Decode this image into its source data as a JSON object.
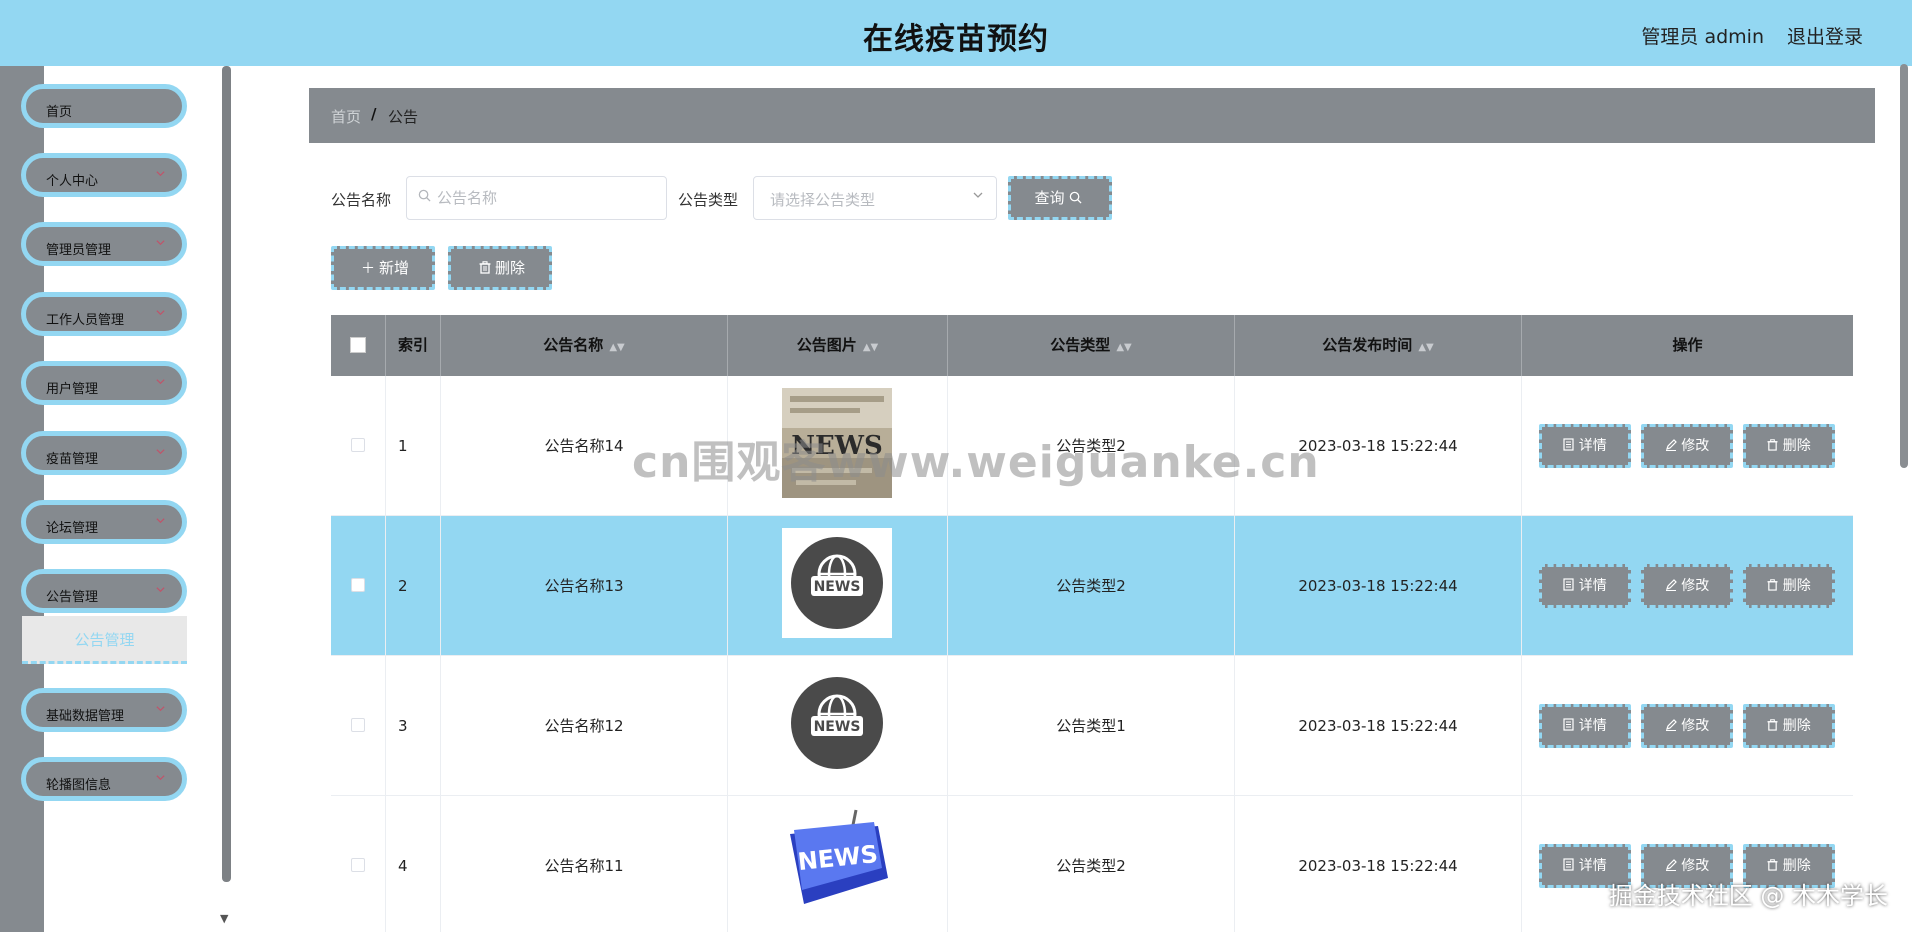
{
  "header": {
    "title": "在线疫苗预约",
    "user_label": "管理员 admin",
    "logout_label": "退出登录"
  },
  "sidebar": {
    "items": [
      {
        "label": "首页",
        "has_chevron": false
      },
      {
        "label": "个人中心",
        "has_chevron": true
      },
      {
        "label": "管理员管理",
        "has_chevron": true
      },
      {
        "label": "工作人员管理",
        "has_chevron": true
      },
      {
        "label": "用户管理",
        "has_chevron": true
      },
      {
        "label": "疫苗管理",
        "has_chevron": true
      },
      {
        "label": "论坛管理",
        "has_chevron": true
      },
      {
        "label": "公告管理",
        "has_chevron": true
      },
      {
        "label": "基础数据管理",
        "has_chevron": true
      },
      {
        "label": "轮播图信息",
        "has_chevron": true
      }
    ],
    "active_submenu": "公告管理"
  },
  "breadcrumb": {
    "home": "首页",
    "separator": "/",
    "current": "公告"
  },
  "search": {
    "name_label": "公告名称",
    "name_placeholder": "公告名称",
    "type_label": "公告类型",
    "type_placeholder": "请选择公告类型",
    "query_label": "查询"
  },
  "actions": {
    "add_label": "新增",
    "delete_label": "删除"
  },
  "table": {
    "columns": [
      "索引",
      "公告名称",
      "公告图片",
      "公告类型",
      "公告发布时间",
      "操作"
    ],
    "rows": [
      {
        "index": "1",
        "name": "公告名称14",
        "image": "news-photo",
        "type": "公告类型2",
        "time": "2023-03-18 15:22:44"
      },
      {
        "index": "2",
        "name": "公告名称13",
        "image": "news-globe",
        "type": "公告类型2",
        "time": "2023-03-18 15:22:44"
      },
      {
        "index": "3",
        "name": "公告名称12",
        "image": "news-globe",
        "type": "公告类型1",
        "time": "2023-03-18 15:22:44"
      },
      {
        "index": "4",
        "name": "公告名称11",
        "image": "news-key",
        "type": "公告类型2",
        "time": "2023-03-18 15:22:44"
      }
    ],
    "highlighted_row": 1,
    "op_labels": {
      "detail": "详情",
      "edit": "修改",
      "delete": "删除"
    }
  },
  "thumbs": {
    "photo_text": "NEWS",
    "globe_text": "NEWS",
    "key_text": "NEWS"
  },
  "watermarks": {
    "center": "cn围观客www.weiguanke.cn",
    "corner": "掘金技术社区 @ 木木学长"
  },
  "colors": {
    "accent": "#93d7f2",
    "gray": "#858a8f"
  }
}
